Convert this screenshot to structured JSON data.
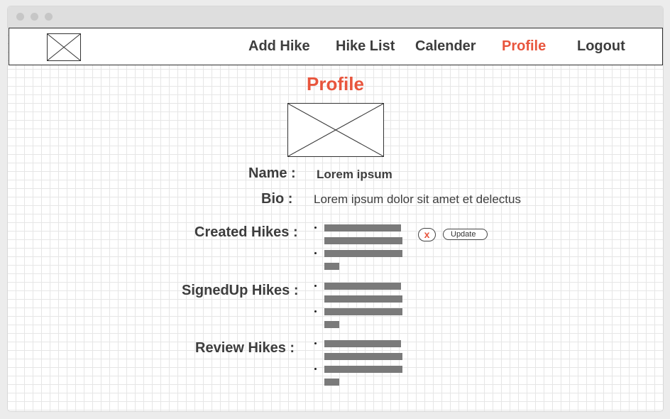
{
  "nav": {
    "items": [
      {
        "label": "Add Hike"
      },
      {
        "label": "Hike List"
      },
      {
        "label": "Calender"
      },
      {
        "label": "Profile"
      },
      {
        "label": "Logout"
      }
    ],
    "active": "Profile",
    "logo_icon": "image-placeholder-icon"
  },
  "profile": {
    "title": "Profile",
    "avatar_icon": "image-placeholder-icon",
    "name_label": "Name :",
    "name_value": "Lorem ipsum",
    "bio_label": "Bio :",
    "bio_value": "Lorem ipsum dolor sit amet et delectus"
  },
  "sections": {
    "created_label": "Created Hikes :",
    "signedup_label": "SignedUp Hikes :",
    "review_label": "Review Hikes :"
  },
  "actions": {
    "delete_label": "x",
    "update_label": "Update"
  },
  "colors": {
    "accent": "#e8553d",
    "text": "#3d3d3d",
    "placeholder_bar": "#7a7a7a",
    "grid": "#e6e6e6"
  }
}
